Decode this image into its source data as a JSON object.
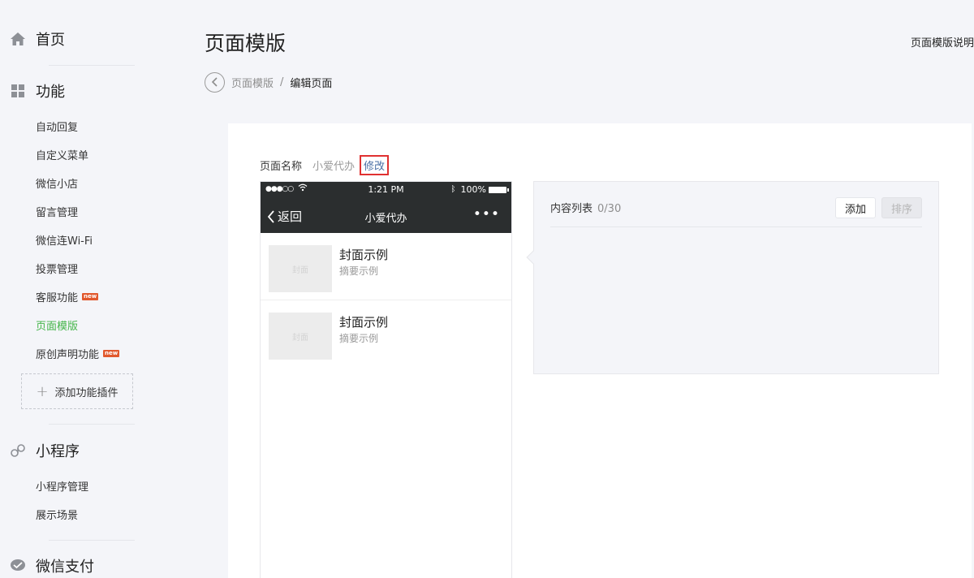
{
  "sidebar": {
    "home": "首页",
    "function_section": "功能",
    "function_items": [
      {
        "label": "自动回复"
      },
      {
        "label": "自定义菜单"
      },
      {
        "label": "微信小店"
      },
      {
        "label": "留言管理"
      },
      {
        "label": "微信连Wi-Fi"
      },
      {
        "label": "投票管理"
      },
      {
        "label": "客服功能",
        "badge": "new"
      },
      {
        "label": "页面模版",
        "active": true
      },
      {
        "label": "原创声明功能",
        "badge": "new"
      }
    ],
    "add_plugin": "添加功能插件",
    "mini_program_section": "小程序",
    "mini_program_items": [
      {
        "label": "小程序管理"
      },
      {
        "label": "展示场景"
      }
    ],
    "pay_section": "微信支付"
  },
  "header": {
    "title": "页面模版",
    "help_link": "页面模版说明"
  },
  "breadcrumb": {
    "parent": "页面模版",
    "separator": "/",
    "current": "编辑页面"
  },
  "page_name": {
    "label": "页面名称",
    "value": "小爱代办",
    "edit": "修改"
  },
  "phone": {
    "signal": "●●●○○",
    "time": "1:21 PM",
    "battery": "100%",
    "back": "返回",
    "title": "小爱代办",
    "more": "•••",
    "articles": [
      {
        "cover": "封面",
        "title": "封面示例",
        "summary": "摘要示例"
      },
      {
        "cover": "封面",
        "title": "封面示例",
        "summary": "摘要示例"
      }
    ]
  },
  "content_list": {
    "title": "内容列表",
    "count": "0/30",
    "add_button": "添加",
    "sort_button": "排序"
  },
  "colors": {
    "accent": "#44b549",
    "link": "#4a6fa5",
    "highlight_border": "#e03131",
    "badge": "#e1582d",
    "phone_header": "#2b2e2f"
  }
}
